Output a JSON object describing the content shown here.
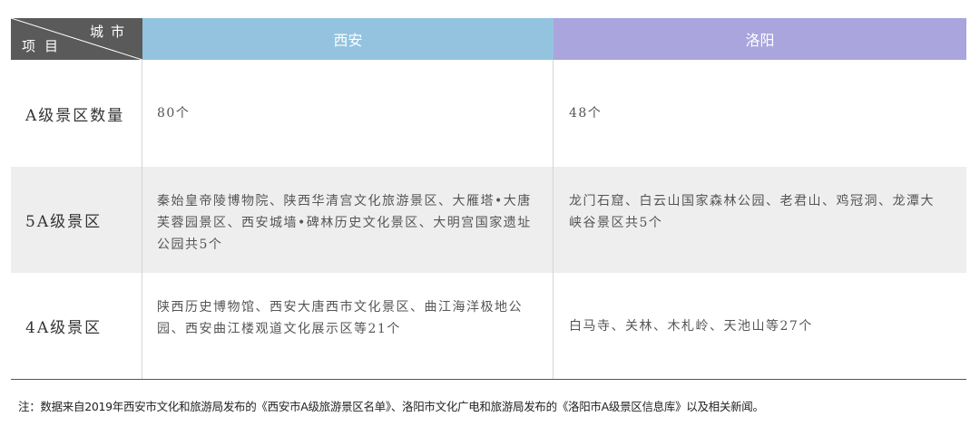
{
  "header": {
    "corner_top": "城市",
    "corner_bottom": "项目",
    "col_xian": "西安",
    "col_luoyang": "洛阳"
  },
  "rows": [
    {
      "label": "A级景区数量",
      "xian": "80个",
      "luoyang": "48个"
    },
    {
      "label": "5A级景区",
      "xian": "秦始皇帝陵博物院、陕西华清宫文化旅游景区、大雁塔•大唐芙蓉园景区、西安城墙•碑林历史文化景区、大明宫国家遗址公园共5个",
      "luoyang": "龙门石窟、白云山国家森林公园、老君山、鸡冠洞、龙潭大峡谷景区共5个"
    },
    {
      "label": "4A级景区",
      "xian": "陕西历史博物馆、西安大唐西市文化景区、曲江海洋极地公园、西安曲江楼观道文化展示区等21个",
      "luoyang": "白马寺、关林、木札岭、天池山等27个"
    }
  ],
  "note": "注：数据来自2019年西安市文化和旅游局发布的《西安市A级旅游景区名单》、洛阳市文化广电和旅游局发布的《洛阳市A级景区信息库》以及相关新闻。",
  "colors": {
    "corner_bg": "#5a5a5a",
    "xian_header_bg": "#93c3df",
    "luoyang_header_bg": "#aaa5dc",
    "alt_row_bg": "#eeeeee"
  }
}
